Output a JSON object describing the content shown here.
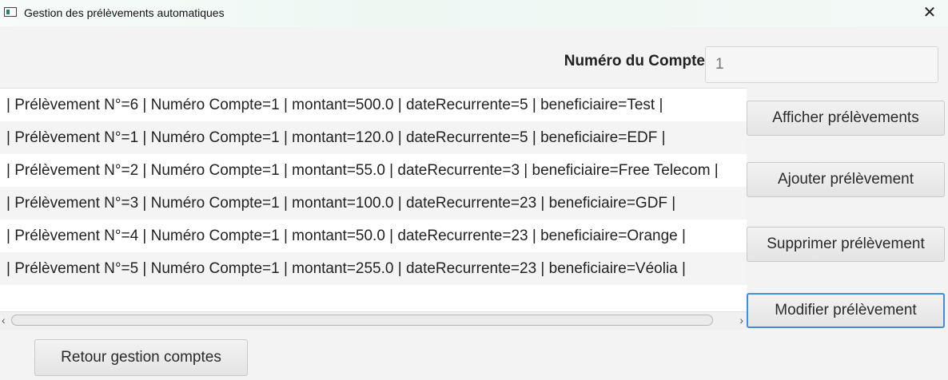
{
  "window": {
    "title": "Gestion des prélèvements automatiques"
  },
  "account": {
    "label": "Numéro du Compte",
    "placeholder": "1"
  },
  "list": {
    "rows": [
      "| Prélèvement N°=6 | Numéro Compte=1 | montant=500.0 | dateRecurrente=5 | beneficiaire=Test |",
      "| Prélèvement N°=1 | Numéro Compte=1 | montant=120.0 | dateRecurrente=5 | beneficiaire=EDF |",
      "| Prélèvement N°=2 | Numéro Compte=1 | montant=55.0 | dateRecurrente=3 | beneficiaire=Free Telecom |",
      "| Prélèvement N°=3 | Numéro Compte=1 | montant=100.0 | dateRecurrente=23 | beneficiaire=GDF |",
      "| Prélèvement N°=4 | Numéro Compte=1 | montant=50.0 | dateRecurrente=23 | beneficiaire=Orange |",
      "| Prélèvement N°=5 | Numéro Compte=1 | montant=255.0 | dateRecurrente=23 | beneficiaire=Véolia |"
    ]
  },
  "buttons": {
    "afficher": "Afficher prélèvements",
    "ajouter": "Ajouter prélèvement",
    "supprimer": "Supprimer prélèvement",
    "modifier": "Modifier prélèvement",
    "retour": "Retour gestion comptes"
  },
  "icons": {
    "app": "window-app-icon",
    "close": "close-icon"
  }
}
